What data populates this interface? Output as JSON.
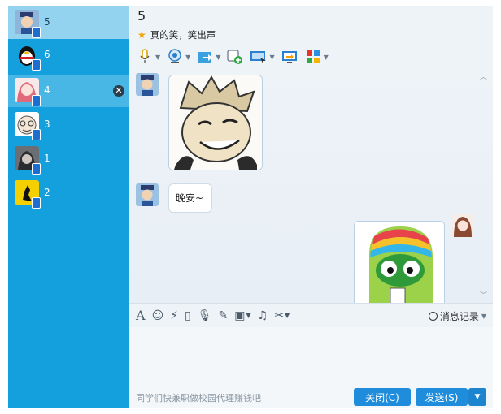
{
  "contacts": [
    {
      "name": "5",
      "state": "highlighted"
    },
    {
      "name": "6",
      "state": "normal"
    },
    {
      "name": "4",
      "state": "selected"
    },
    {
      "name": "3",
      "state": "normal"
    },
    {
      "name": "1",
      "state": "normal"
    },
    {
      "name": "2",
      "state": "normal"
    }
  ],
  "chat": {
    "title": "5",
    "signature": "真的笑，笑出声",
    "toolbar_icons": [
      "microphone-icon",
      "webcam-icon",
      "file-transfer-icon",
      "add-app-icon",
      "screen-share-icon",
      "remote-assist-icon",
      "apps-grid-icon"
    ],
    "messages": [
      {
        "from": "5",
        "type": "image",
        "content": "anime-grin-sticker"
      },
      {
        "from": "5",
        "type": "text",
        "content": "晚安~"
      },
      {
        "from": "me",
        "type": "image",
        "content": "colorful-bird-sticker"
      }
    ]
  },
  "input": {
    "tools": [
      "font-icon",
      "emoji-icon",
      "shake-icon",
      "voice-msg-icon",
      "mic-icon",
      "screenshot-icon",
      "image-icon",
      "music-icon",
      "scissors-icon"
    ],
    "history_label": "消息记录",
    "ad_text": "同学们快兼职做校园代理赚钱吧",
    "close_label": "关闭(C)",
    "send_label": "发送(S)"
  },
  "colors": {
    "sidebar": "#13a0dd",
    "button": "#1f8ddb",
    "star": "#f0a500"
  }
}
